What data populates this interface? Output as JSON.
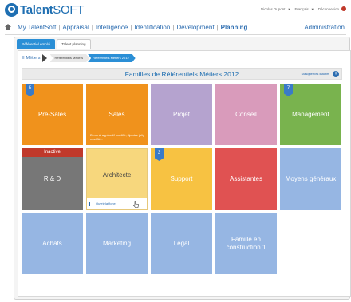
{
  "app": {
    "logo_text_bold": "Talent",
    "logo_text_rest": "SOFT",
    "user_name": "Nicolas Dupont",
    "language": "Français",
    "logout": "Déconnexion"
  },
  "nav": {
    "items": [
      {
        "label": "My TalentSoft"
      },
      {
        "label": "Appraisal"
      },
      {
        "label": "Intelligence"
      },
      {
        "label": "Identification"
      },
      {
        "label": "Development"
      },
      {
        "label": "Planning"
      }
    ],
    "separator": "|",
    "admin": "Administration"
  },
  "tabs": [
    {
      "label": "Référentiel emploi"
    },
    {
      "label": "Talent planning"
    }
  ],
  "breadcrumb": {
    "menu_glyph": "≡",
    "first": "Métiers",
    "items": [
      {
        "label": "Référentiels Métiers"
      },
      {
        "label": "Référentiels Métiers 2012"
      }
    ]
  },
  "section": {
    "title": "Familles de Référentiels Métiers 2012",
    "link": "Masquer les inactifs",
    "plus": "+"
  },
  "tiles": [
    {
      "label": "Pré-Sales",
      "color": "#f0921c",
      "badge": "5"
    },
    {
      "label": "Sales",
      "color": "#f0921c",
      "subtext": "Devenir applicatif modifié, Ajoutez joliy modifié..."
    },
    {
      "label": "Projet",
      "color": "#b5a3cf"
    },
    {
      "label": "Conseil",
      "color": "#d99bbb"
    },
    {
      "label": "Management",
      "color": "#79b34e",
      "badge": "7"
    },
    {
      "label": "R & D",
      "color": "#777777",
      "inactive": "Inactive"
    },
    {
      "label": "Architecte",
      "color": "#f7d77d",
      "fiche": "Ouvrir la fiche"
    },
    {
      "label": "Support",
      "color": "#f7c242",
      "badge": "3"
    },
    {
      "label": "Assistantes",
      "color": "#e05252"
    },
    {
      "label": "Moyens généraux",
      "color": "#96b6e3"
    },
    {
      "label": "Achats",
      "color": "#96b6e3"
    },
    {
      "label": "Marketing",
      "color": "#96b6e3"
    },
    {
      "label": "Legal",
      "color": "#96b6e3"
    },
    {
      "label": "Famille en construction 1",
      "color": "#96b6e3"
    }
  ]
}
